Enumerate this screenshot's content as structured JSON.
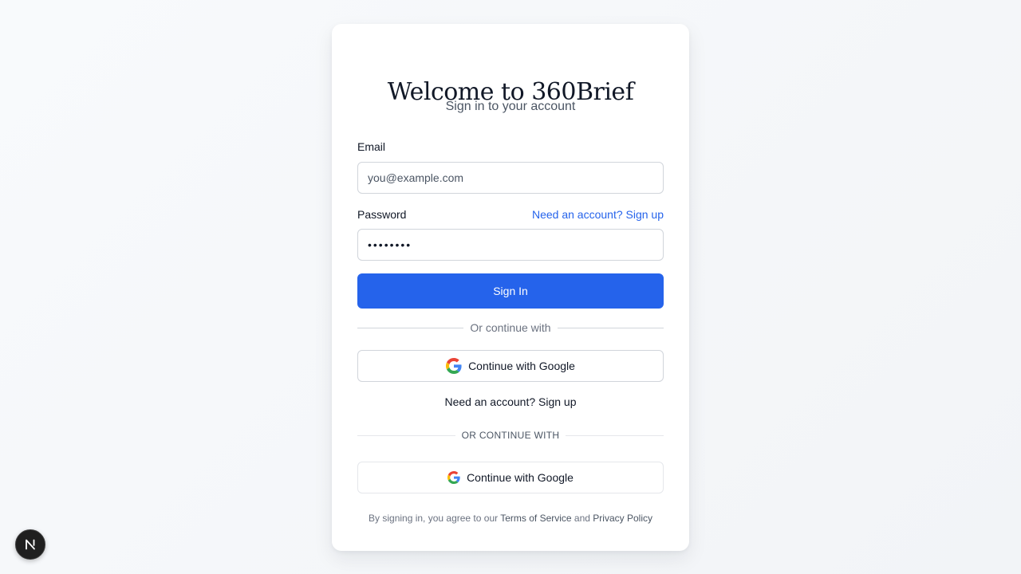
{
  "header": {
    "title": "Welcome to 360Brief",
    "subtitle": "Sign in to your account"
  },
  "form": {
    "email_label": "Email",
    "email_placeholder": "you@example.com",
    "password_label": "Password",
    "password_value": "••••••••",
    "signup_link_top": "Need an account? Sign up",
    "submit_label": "Sign In"
  },
  "alt_auth": {
    "divider_text": "Or continue with",
    "google_label": "Continue with Google",
    "signup_link": "Need an account? Sign up",
    "divider_text_2": "OR CONTINUE WITH",
    "google_label_2": "Continue with Google"
  },
  "footer": {
    "prefix": "By signing in, you agree to our ",
    "terms": "Terms of Service",
    "and": " and ",
    "privacy": "Privacy Policy"
  },
  "dev_badge": {
    "letter": "N"
  },
  "colors": {
    "accent": "#2563eb",
    "google_blue": "#4285F4",
    "google_red": "#EA4335",
    "google_yellow": "#FBBC05",
    "google_green": "#34A853"
  },
  "icons": {
    "google": "google-icon",
    "dev_badge": "nextjs-icon"
  }
}
